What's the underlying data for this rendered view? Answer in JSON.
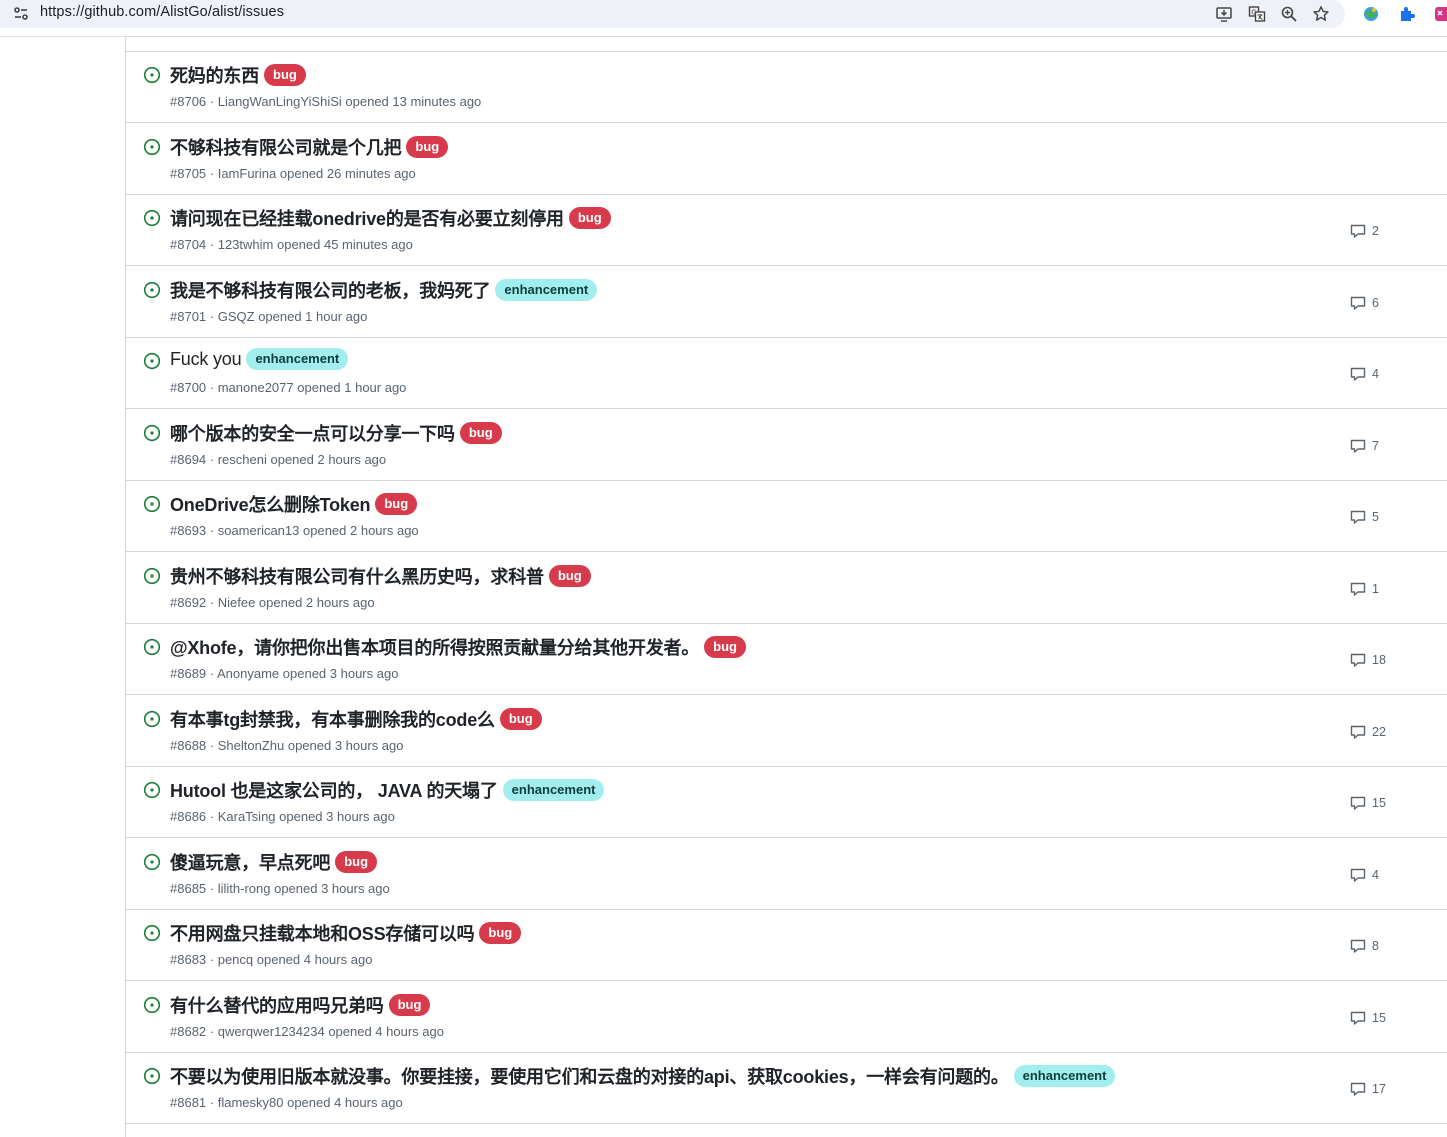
{
  "browser": {
    "url": "https://github.com/AlistGo/alist/issues"
  },
  "issues": [
    {
      "title": "死妈的东西",
      "label": "bug",
      "number": "#8706",
      "author": "LiangWanLingYiShiSi",
      "time": "opened 13 minutes ago",
      "comments": ""
    },
    {
      "title": "不够科技有限公司就是个几把",
      "label": "bug",
      "number": "#8705",
      "author": "IamFurina",
      "time": "opened 26 minutes ago",
      "comments": ""
    },
    {
      "title": "请问现在已经挂载onedrive的是否有必要立刻停用",
      "label": "bug",
      "number": "#8704",
      "author": "123twhim",
      "time": "opened 45 minutes ago",
      "comments": "2"
    },
    {
      "title": "我是不够科技有限公司的老板，我妈死了",
      "label": "enhancement",
      "number": "#8701",
      "author": "GSQZ",
      "time": "opened 1 hour ago",
      "comments": "6"
    },
    {
      "title": "Fuck you",
      "label": "enhancement",
      "number": "#8700",
      "author": "manone2077",
      "time": "opened 1 hour ago",
      "comments": "4"
    },
    {
      "title": "哪个版本的安全一点可以分享一下吗",
      "label": "bug",
      "number": "#8694",
      "author": "rescheni",
      "time": "opened 2 hours ago",
      "comments": "7"
    },
    {
      "title": "OneDrive怎么删除Token",
      "label": "bug",
      "number": "#8693",
      "author": "soamerican13",
      "time": "opened 2 hours ago",
      "comments": "5"
    },
    {
      "title": "贵州不够科技有限公司有什么黑历史吗，求科普",
      "label": "bug",
      "number": "#8692",
      "author": "Niefee",
      "time": "opened 2 hours ago",
      "comments": "1"
    },
    {
      "title": "@Xhofe，请你把你出售本项目的所得按照贡献量分给其他开发者。",
      "label": "bug",
      "number": "#8689",
      "author": "Anonyame",
      "time": "opened 3 hours ago",
      "comments": "18"
    },
    {
      "title": "有本事tg封禁我，有本事删除我的code么",
      "label": "bug",
      "number": "#8688",
      "author": "SheltonZhu",
      "time": "opened 3 hours ago",
      "comments": "22"
    },
    {
      "title": "Hutool 也是这家公司的， JAVA 的天塌了",
      "label": "enhancement",
      "number": "#8686",
      "author": "KaraTsing",
      "time": "opened 3 hours ago",
      "comments": "15"
    },
    {
      "title": "傻逼玩意，早点死吧",
      "label": "bug",
      "number": "#8685",
      "author": "lilith-rong",
      "time": "opened 3 hours ago",
      "comments": "4"
    },
    {
      "title": "不用网盘只挂载本地和OSS存储可以吗",
      "label": "bug",
      "number": "#8683",
      "author": "pencq",
      "time": "opened 4 hours ago",
      "comments": "8"
    },
    {
      "title": "有什么替代的应用吗兄弟吗",
      "label": "bug",
      "number": "#8682",
      "author": "qwerqwer1234234",
      "time": "opened 4 hours ago",
      "comments": "15"
    },
    {
      "title": "不要以为使用旧版本就没事。你要挂接，要使用它们和云盘的对接的api、获取cookies，一样会有问题的。",
      "label": "enhancement",
      "number": "#8681",
      "author": "flamesky80",
      "time": "opened 4 hours ago",
      "comments": "17"
    }
  ]
}
